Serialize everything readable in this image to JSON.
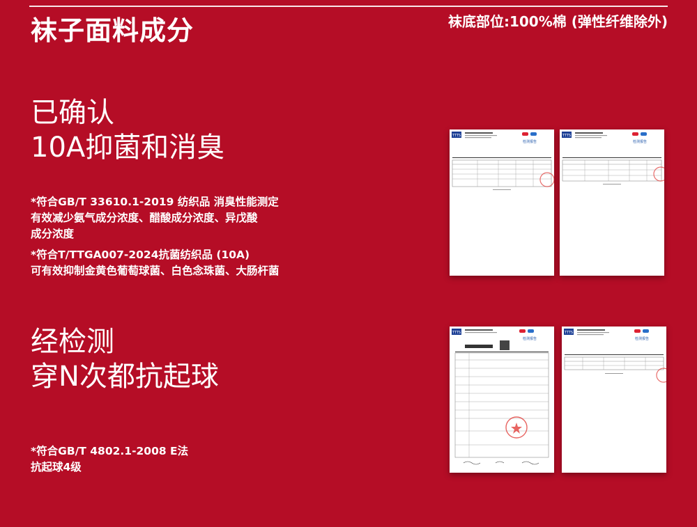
{
  "header": {
    "title": "袜子面料成分",
    "composition": "袜底部位:100%棉 (弹性纤维除外)"
  },
  "section1": {
    "headline_line1": "已确认",
    "headline_line2": "10A抑菌和消臭",
    "note1_line1": "*符合GB/T 33610.1-2019 纺织品 消臭性能测定",
    "note1_line2": "有效减少氨气成分浓度、醋酸成分浓度、异戊酸",
    "note1_line3": "成分浓度",
    "note2_line1": "*符合T/TTGA007-2024抗菌纺织品 (10A)",
    "note2_line2": "可有效抑制金黄色葡萄球菌、白色念珠菌、大肠杆菌"
  },
  "section2": {
    "headline_line1": "经检测",
    "headline_line2": "穿N次都抗起球",
    "note_line1": "*符合GB/T 4802.1-2008 E法",
    "note_line2": "抗起球4级"
  },
  "certificates": {
    "logo_text": "TTTS",
    "report_title": "检测报告"
  },
  "colors": {
    "background": "#b50d26",
    "text": "#ffffff",
    "seal": "#e0312d"
  }
}
